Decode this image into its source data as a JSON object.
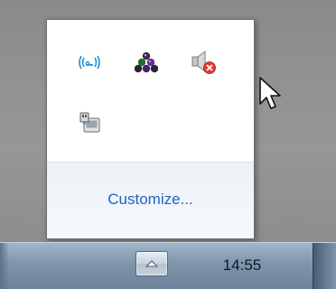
{
  "flyout": {
    "icons": [
      {
        "name": "network-icon",
        "description": "wireless network"
      },
      {
        "name": "app-tray-icon",
        "description": "tray app"
      },
      {
        "name": "volume-muted-icon",
        "description": "speakers muted"
      },
      {
        "name": "hardware-icon",
        "description": "safely remove hardware"
      }
    ],
    "customize_label": "Customize..."
  },
  "taskbar": {
    "clock_time": "14:55",
    "show_hidden_icon": "up-arrow"
  },
  "colors": {
    "link": "#1d64c2",
    "network_icon": "#2a8fd4",
    "mute_badge": "#e23a32",
    "app_icon": "#4a1e6e"
  }
}
